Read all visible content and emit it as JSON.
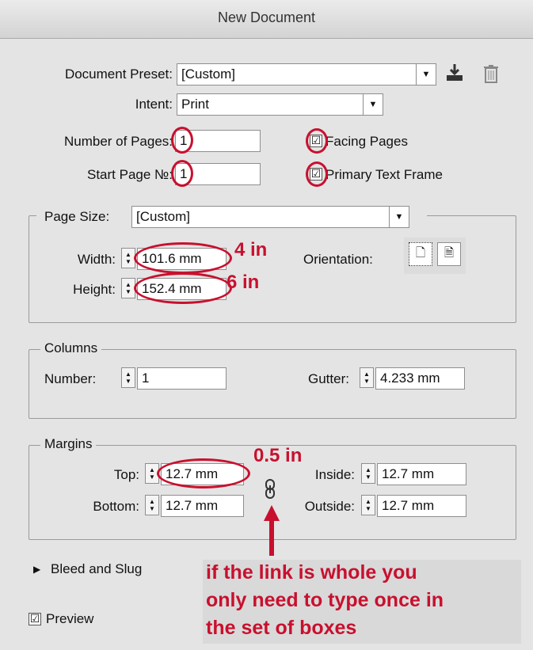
{
  "dialog": {
    "title": "New Document"
  },
  "preset": {
    "label": "Document Preset:",
    "value": "[Custom]",
    "save_icon": "download-icon",
    "delete_icon": "trash-icon"
  },
  "intent": {
    "label": "Intent:",
    "value": "Print"
  },
  "pages": {
    "number_label": "Number of Pages:",
    "number_value": "1",
    "start_label": "Start Page №:",
    "start_value": "1",
    "facing_label": "Facing Pages",
    "facing_checked": "☑",
    "primary_label": "Primary Text Frame",
    "primary_checked": "☑"
  },
  "page_size": {
    "label": "Page Size:",
    "value": "[Custom]",
    "width_label": "Width:",
    "width_value": "101.6 mm",
    "height_label": "Height:",
    "height_value": "152.4 mm",
    "orientation_label": "Orientation:"
  },
  "columns": {
    "legend": "Columns",
    "number_label": "Number:",
    "number_value": "1",
    "gutter_label": "Gutter:",
    "gutter_value": "4.233 mm"
  },
  "margins": {
    "legend": "Margins",
    "top_label": "Top:",
    "top_value": "12.7 mm",
    "bottom_label": "Bottom:",
    "bottom_value": "12.7 mm",
    "inside_label": "Inside:",
    "inside_value": "12.7 mm",
    "outside_label": "Outside:",
    "outside_value": "12.7 mm",
    "link_icon": "chain-link-icon"
  },
  "bleed": {
    "label": "Bleed and Slug"
  },
  "preview": {
    "label": "Preview",
    "checked": "☑"
  },
  "annotations": {
    "width_inches": "4 in",
    "height_inches": "6 in",
    "margin_inches": "0.5 in",
    "link_note_line1": "if the link is whole you",
    "link_note_line2": "only need to type once in",
    "link_note_line3": "the set of boxes",
    "color": "#c8102e"
  }
}
